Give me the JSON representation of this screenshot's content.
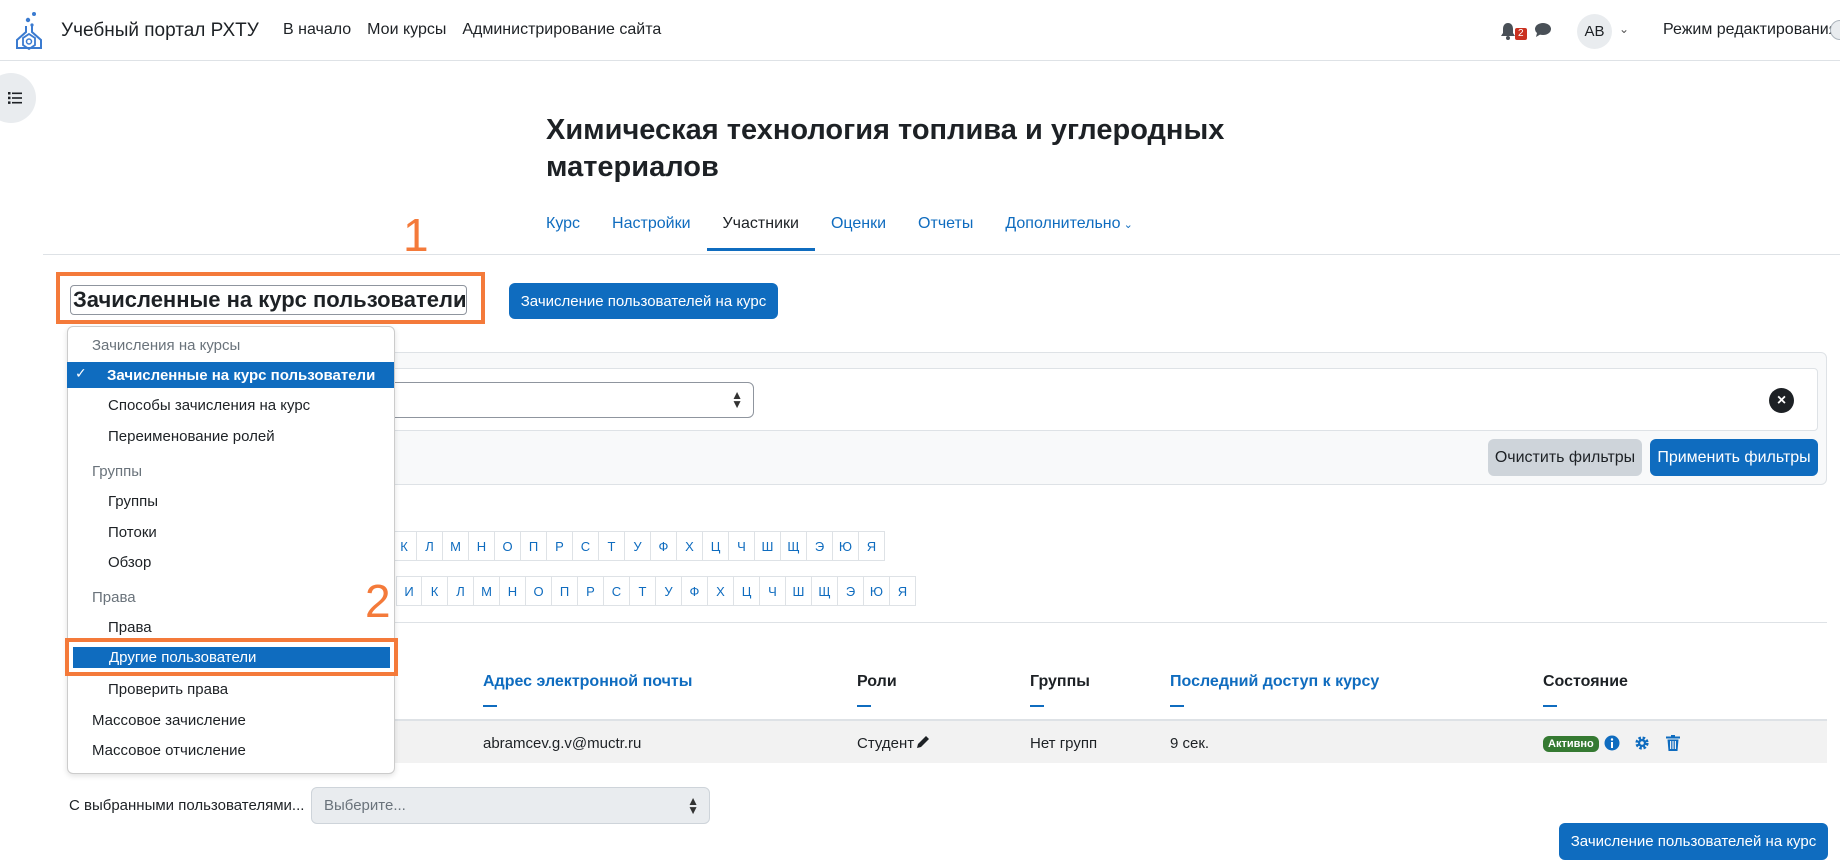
{
  "navbar": {
    "site_name": "Учебный портал РХТУ",
    "links": [
      "В начало",
      "Мои курсы",
      "Администрирование сайта"
    ],
    "notification_count": "2",
    "avatar_initials": "АВ",
    "edit_mode_label": "Режим редактирования"
  },
  "course": {
    "title": "Химическая технология топлива и углеродных материалов"
  },
  "tabs": [
    {
      "label": "Курс"
    },
    {
      "label": "Настройки"
    },
    {
      "label": "Участники",
      "active": true
    },
    {
      "label": "Оценки"
    },
    {
      "label": "Отчеты"
    },
    {
      "label": "Дополнительно"
    }
  ],
  "annotations": {
    "one": "1",
    "two": "2"
  },
  "page_select": {
    "value": "Зачисленные на курс пользователи"
  },
  "buttons": {
    "enrol_top": "Зачисление пользователей на курс",
    "enrol_bottom": "Зачисление пользователей на курс",
    "clear_filters": "Очистить фильтры",
    "apply_filters": "Применить фильтры"
  },
  "menu": {
    "group_enrolments": "Зачисления на курсы",
    "item_enrolled_users": "Зачисленные на курс пользователи",
    "item_enrolment_methods": "Способы зачисления на курс",
    "item_rename_roles": "Переименование ролей",
    "group_groups": "Группы",
    "item_groups": "Группы",
    "item_groupings": "Потоки",
    "item_overview": "Обзор",
    "group_permissions": "Права",
    "item_permissions": "Права",
    "item_other_users": "Другие пользователи",
    "item_check_permissions": "Проверить права",
    "item_bulk_enrol": "Массовое зачисление",
    "item_bulk_unenrol": "Массовое отчисление"
  },
  "letters_first": [
    "К",
    "Л",
    "М",
    "Н",
    "О",
    "П",
    "Р",
    "С",
    "Т",
    "У",
    "Ф",
    "Х",
    "Ц",
    "Ч",
    "Ш",
    "Щ",
    "Э",
    "Ю",
    "Я"
  ],
  "letters_last": [
    "И",
    "К",
    "Л",
    "М",
    "Н",
    "О",
    "П",
    "Р",
    "С",
    "Т",
    "У",
    "Ф",
    "Х",
    "Ц",
    "Ч",
    "Ш",
    "Щ",
    "Э",
    "Ю",
    "Я"
  ],
  "table": {
    "headers": {
      "email": "Адрес электронной почты",
      "roles": "Роли",
      "groups": "Группы",
      "last_access": "Последний доступ к курсу",
      "status": "Состояние"
    },
    "row": {
      "email": "abramcev.g.v@muctr.ru",
      "role": "Студент",
      "groups": "Нет групп",
      "last_access": "9 сек.",
      "status": "Активно"
    }
  },
  "bulk": {
    "label": "С выбранными пользователями...",
    "placeholder": "Выберите..."
  },
  "colors": {
    "primary": "#0f6cbf",
    "annotation": "#f47a3a",
    "active_badge": "#357a32"
  }
}
